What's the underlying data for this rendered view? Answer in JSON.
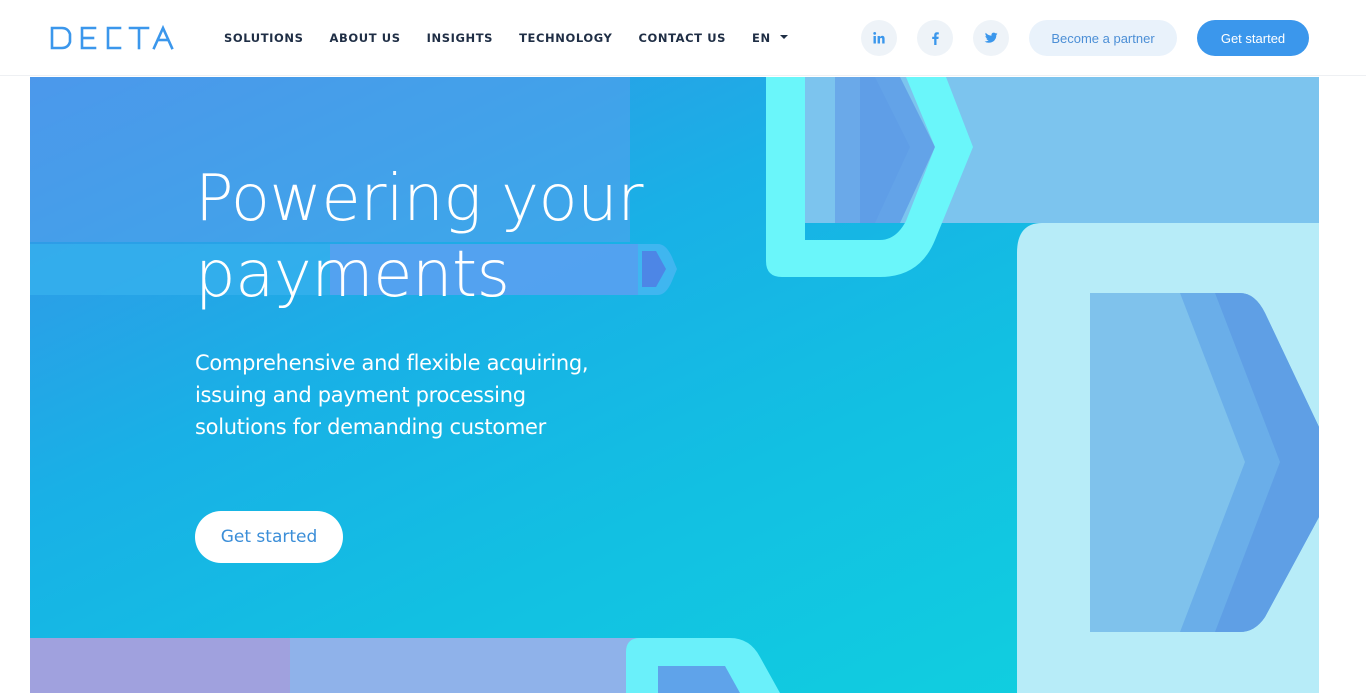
{
  "brand": {
    "logo_text": "DECTA",
    "color": "#3b97ec"
  },
  "nav": {
    "items": [
      {
        "label": "SOLUTIONS"
      },
      {
        "label": "ABOUT US"
      },
      {
        "label": "INSIGHTS"
      },
      {
        "label": "TECHNOLOGY"
      },
      {
        "label": "CONTACT US"
      }
    ],
    "language": "EN"
  },
  "social": [
    "linkedin-icon",
    "facebook-icon",
    "twitter-icon"
  ],
  "header_buttons": {
    "partner_label": "Become a partner",
    "started_label": "Get started"
  },
  "hero": {
    "title_line1": "Powering your",
    "title_line2": "payments",
    "subtitle_line1": "Comprehensive and flexible acquiring,",
    "subtitle_line2": "issuing and payment processing",
    "subtitle_line3": "solutions for demanding customer",
    "cta_label": "Get started"
  },
  "colors": {
    "accent": "#3b97ec",
    "hero_gradient_start": "#3c8fe8",
    "hero_gradient_end": "#10d3df",
    "nav_text": "#1f2e45"
  }
}
